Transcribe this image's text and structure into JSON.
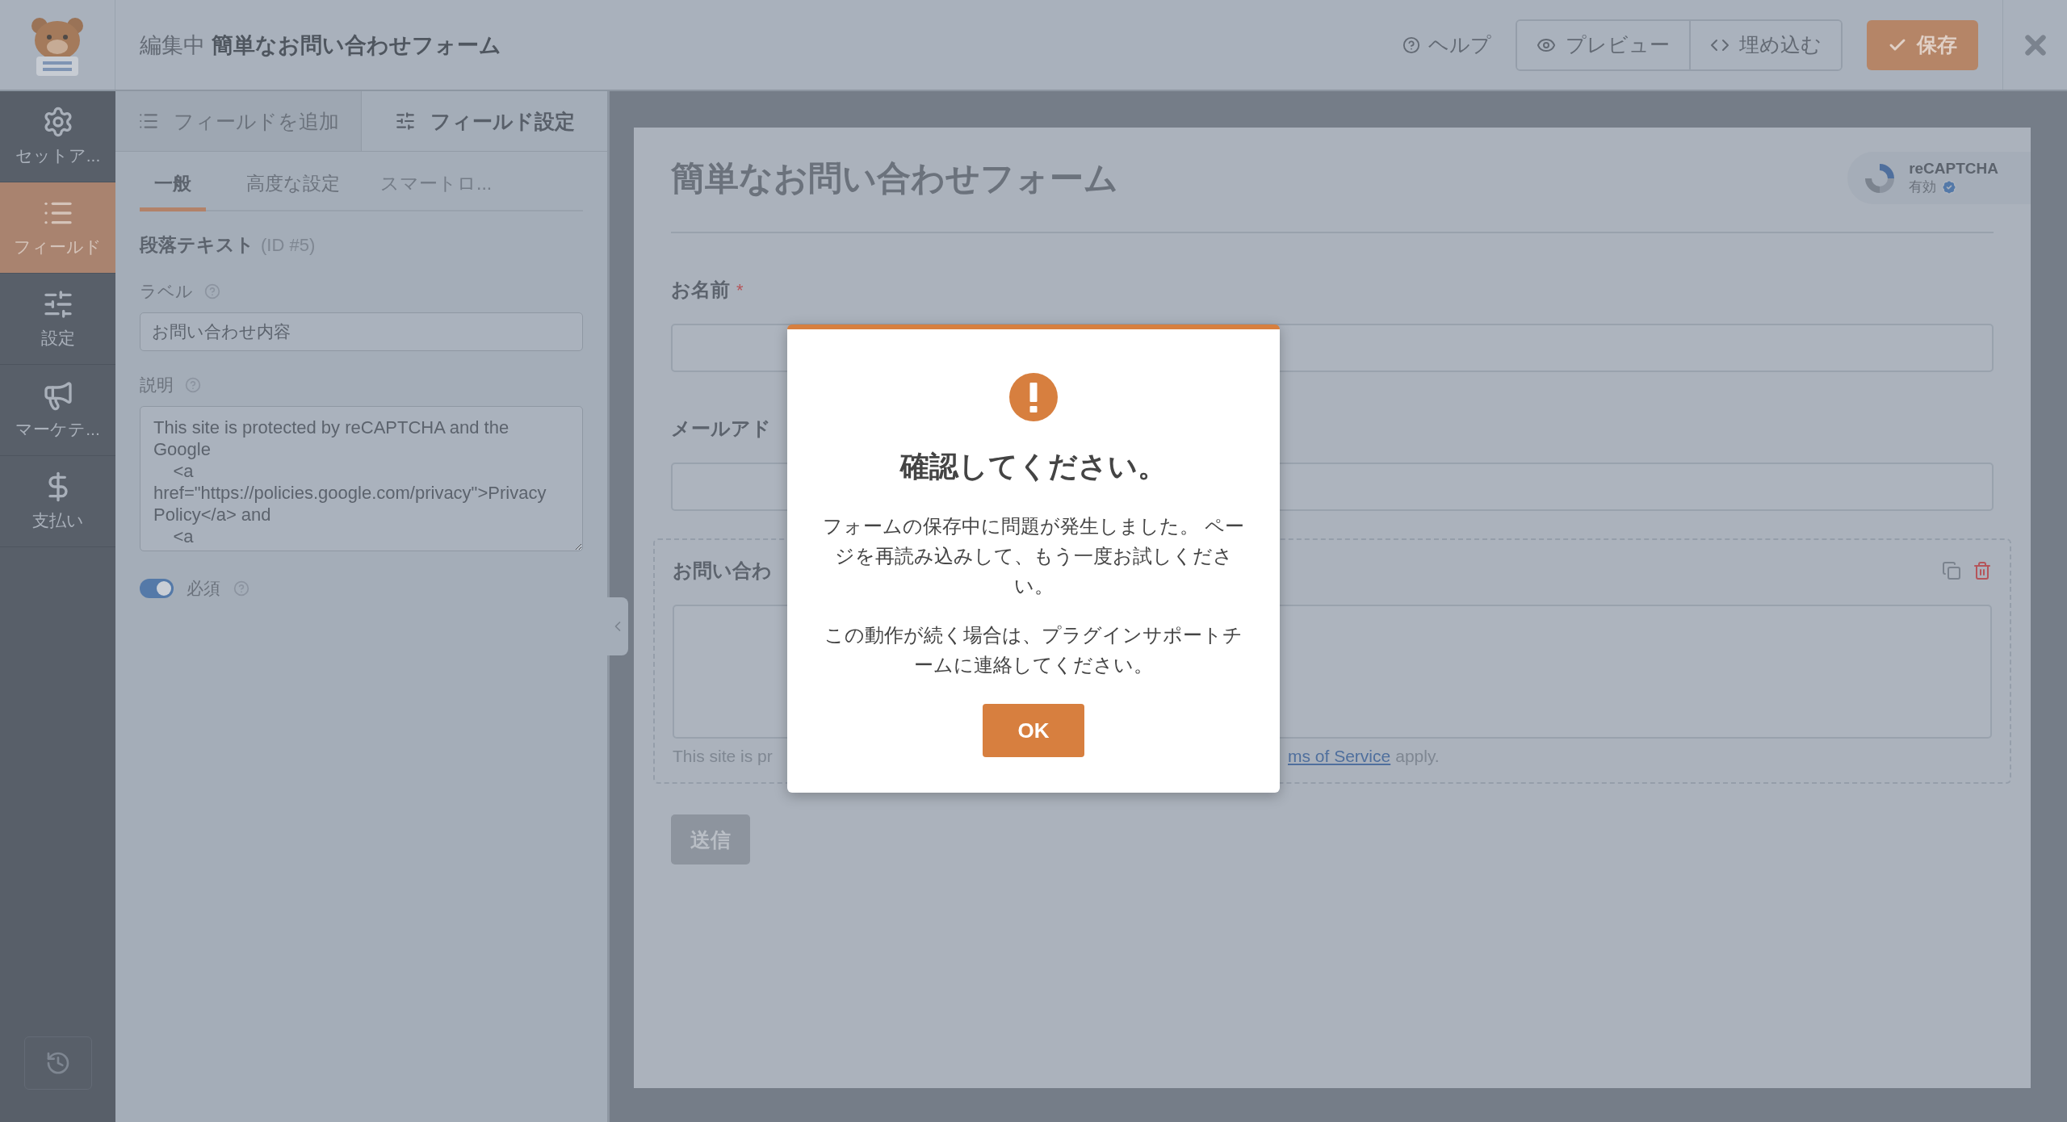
{
  "header": {
    "title": "編集中 **簡単なお問い合わせフォーム**",
    "help": "ヘルプ",
    "buttons": [
      {
        "label": "プレビュー",
        "kind": "preview"
      },
      {
        "label": "埋め込む",
        "kind": "embed"
      }
    ],
    "save": "保存"
  },
  "sidebar": {
    "items": [
      {
        "label": "セットア...",
        "selected": false
      },
      {
        "label": "フィールド",
        "selected": true
      },
      {
        "label": "設定",
        "selected": false
      },
      {
        "label": "マーケテ...",
        "selected": false
      },
      {
        "label": "支払い",
        "selected": false
      }
    ]
  },
  "panel": {
    "tabs": [
      {
        "label": "フィールドを追加",
        "selected": false
      },
      {
        "label": "フィールド設定",
        "selected": true
      }
    ],
    "subtabs": [
      {
        "label": "一般",
        "selected": true
      },
      {
        "label": "高度な設定",
        "selected": false
      },
      {
        "label": "スマートロ...",
        "selected": false
      }
    ],
    "field_title": "段落テキスト",
    "field_id": "(ID #5)",
    "label_caption": "ラベル",
    "label_value": "お問い合わせ内容",
    "description_caption": "説明",
    "description_value": "This site is protected by reCAPTCHA and the Google\n    <a href=\"https://policies.google.com/privacy\">Privacy Policy</a> and\n    <a",
    "required": {
      "label": "必須",
      "on": true
    }
  },
  "form": {
    "title": "簡単なお問い合わせフォーム",
    "recaptcha": {
      "name": "reCAPTCHA",
      "status": "有効"
    },
    "fields": [
      {
        "label": "お名前",
        "required_mark": "*",
        "kind": "input",
        "selected": false
      },
      {
        "label": "メールアド",
        "kind": "input",
        "selected": false
      },
      {
        "label": "お問い合わ",
        "kind": "textarea",
        "selected": true,
        "note": {
          "text": "This site is pr",
          "link": "ms of Service",
          "after": "apply."
        }
      }
    ],
    "submit": "送信"
  },
  "dialog": {
    "title": "確認してください。",
    "paragraphs": [
      "フォームの保存中に問題が発生しました。 ページを再読み込みして、もう一度お試しください。",
      "この動作が続く場合は、プラグインサポートチームに連絡してください。"
    ],
    "button": "OK"
  }
}
